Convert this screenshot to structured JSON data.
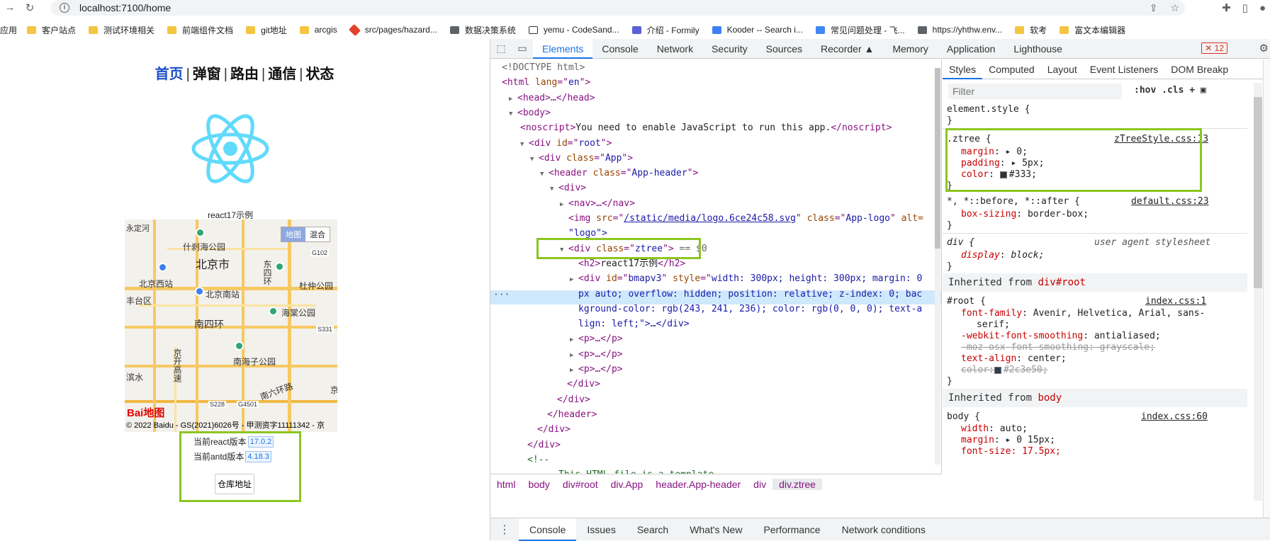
{
  "browser": {
    "url": "localhost:7100/home",
    "bookmarks": [
      {
        "icon": "apps-icon",
        "label": "应用"
      },
      {
        "icon": "folder-icon",
        "label": "客户站点"
      },
      {
        "icon": "folder-icon",
        "label": "测试环境相关"
      },
      {
        "icon": "folder-icon",
        "label": "前端组件文档"
      },
      {
        "icon": "folder-icon",
        "label": "git地址"
      },
      {
        "icon": "folder-icon",
        "label": "arcgis"
      },
      {
        "icon": "gitlab-icon",
        "label": "src/pages/hazard..."
      },
      {
        "icon": "globe-icon",
        "label": "数据决策系统"
      },
      {
        "icon": "codesandbox-icon",
        "label": "yemu - CodeSand..."
      },
      {
        "icon": "formily-icon",
        "label": "介绍 - Formily"
      },
      {
        "icon": "kooder-icon",
        "label": "Kooder -- Search i..."
      },
      {
        "icon": "doc-icon",
        "label": "常见问题处理 - 飞..."
      },
      {
        "icon": "globe-icon",
        "label": "https://yhthw.env..."
      },
      {
        "icon": "folder-icon",
        "label": "软考"
      },
      {
        "icon": "folder-icon",
        "label": "富文本编辑器"
      }
    ]
  },
  "app": {
    "nav": [
      {
        "label": "首页",
        "active": true
      },
      {
        "label": "弹窗",
        "active": false
      },
      {
        "label": "路由",
        "active": false
      },
      {
        "label": "通信",
        "active": false
      },
      {
        "label": "状态",
        "active": false
      }
    ],
    "separator": "|",
    "subtitle": "react17示例",
    "map": {
      "type_buttons": [
        "地图",
        "混合"
      ],
      "labels": {
        "l1": "什刹海公园",
        "l2": "北京市",
        "l3": "东四环",
        "l4": "北京西站",
        "l5": "北京南站",
        "l6": "丰台区",
        "l7": "南四环",
        "l8": "海棠公园",
        "l9": "杜仲公园",
        "l10": "南海子公园",
        "l11": "京开高速",
        "l12": "南六环路",
        "l13": "滨水",
        "l14": "G102",
        "l15": "S331",
        "l16": "S228",
        "l17": "G4501",
        "l18": "京",
        "l19": "永定河"
      },
      "brand": "Bai地图",
      "copyright": "© 2022 Baidu - GS(2021)6026号 - 甲测资字11111342 - 京"
    },
    "versions": [
      {
        "label": "当前react版本",
        "value": "17.0.2"
      },
      {
        "label": "当前antd版本",
        "value": "4.18.3"
      }
    ],
    "repo_button": "仓库地址"
  },
  "devtools": {
    "tabs": [
      "Elements",
      "Console",
      "Network",
      "Security",
      "Sources",
      "Recorder ▲",
      "Memory",
      "Application",
      "Lighthouse"
    ],
    "error_count": "12",
    "dom": {
      "l0": "<!DOCTYPE html>",
      "l1a": "<html ",
      "l1b": "lang",
      "l1c": "=\"",
      "l1d": "en",
      "l1e": "\">",
      "l2a": "<",
      "l2b": "head",
      "l2c": ">…</head>",
      "l3": "<body>",
      "l4a": "<noscript>",
      "l4b": "You need to enable JavaScript to run this app.",
      "l4c": "</noscript>",
      "l5a": "<div ",
      "l5b": "id",
      "l5c": "root",
      "l6a": "<div ",
      "l6b": "class",
      "l6c": "App",
      "l7a": "<header ",
      "l7b": "class",
      "l7c": "App-header",
      "l8": "<div>",
      "l9": "<nav>…</nav>",
      "l10a": "<img ",
      "l10b": "src",
      "l10c": "/static/media/logo.6ce24c58.svg",
      "l10d": "class",
      "l10e": "App-logo",
      "l10f": "alt=",
      "l11": "\"logo\">",
      "l12a": "<div ",
      "l12b": "class",
      "l12c": "ztree",
      "l12d": " == $0",
      "l13a": "<h2>",
      "l13b": "react17示例",
      "l13c": "</h2>",
      "l14a": "<div ",
      "l14b": "id",
      "l14c": "bmapv3",
      "l14d": "style",
      "l14e": "width: 300px; height: 300px; margin: 0",
      "l15": "px auto; overflow: hidden; position: relative; z-index: 0; bac",
      "l16": "kground-color: rgb(243, 241, 236); color: rgb(0, 0, 0); text-a",
      "l17": "lign: left;\">…</div>",
      "l18": "<p>…</p>",
      "l19": "<p>…</p>",
      "l20": "<p>…</p>",
      "l21": "</div>",
      "l22": "</div>",
      "l23": "</header>",
      "l24": "</div>",
      "l25": "</div>",
      "l26": "<!--",
      "l27": "This HTML file is a template."
    },
    "crumbs": [
      "html",
      "body",
      "div#root",
      "div.App",
      "header.App-header",
      "div",
      "div.ztree"
    ],
    "drawer_tabs": [
      "Console",
      "Issues",
      "Search",
      "What's New",
      "Performance",
      "Network conditions"
    ],
    "styles": {
      "tabs": [
        "Styles",
        "Computed",
        "Layout",
        "Event Listeners",
        "DOM Breakp"
      ],
      "filter_placeholder": "Filter",
      "tools": ":hov  .cls  +",
      "element_style": "element.style {",
      "close": "}",
      "ztree_sel": ".ztree {",
      "ztree_src": "zTreeStyle.css:13",
      "ztree_props": [
        {
          "name": "margin",
          "value": "0;"
        },
        {
          "name": "padding",
          "value": "5px;"
        },
        {
          "name": "color",
          "value": "#333;"
        }
      ],
      "univ_sel": "*, *::before, *::after {",
      "univ_src": "default.css:23",
      "univ_prop": "box-sizing",
      "univ_val": "border-box;",
      "div_sel": "div {",
      "div_src": "user agent stylesheet",
      "div_prop": "display",
      "div_val": "block;",
      "inh1_a": "Inherited from ",
      "inh1_b": "div#root",
      "root_sel": "#root {",
      "root_src": "index.css:1",
      "root_p1": "font-family",
      "root_v1": "Avenir, Helvetica, Arial, sans-",
      "root_v1b": "serif;",
      "root_p2": "-webkit-font-smoothing",
      "root_v2": "antialiased;",
      "root_p3": "-moz-osx-font-smoothing: grayscale;",
      "root_p4": "text-align",
      "root_v4": "center;",
      "root_p5": "color:",
      "root_v5": "#2c3e50;",
      "inh2_a": "Inherited from ",
      "inh2_b": "body",
      "body_sel": "body {",
      "body_src": "index.css:60",
      "body_p1": "width",
      "body_v1": "auto;",
      "body_p2": "margin",
      "body_v2": "0 15px;",
      "body_p3": "font-size: 17.5px;"
    }
  },
  "colors": {
    "highlight": "#8cc620",
    "accent": "#1a73e8"
  }
}
